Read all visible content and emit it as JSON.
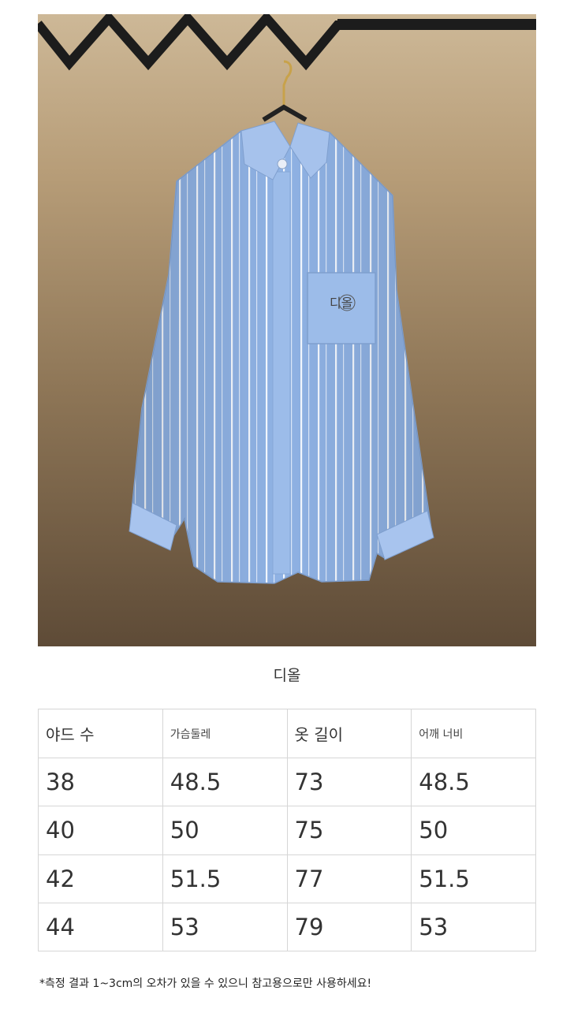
{
  "product": {
    "title": "디올",
    "pocket_logo": "디올"
  },
  "size_table": {
    "headers": [
      "야드 수",
      "가슴둘레",
      "옷 길이",
      "어깨 너비"
    ],
    "rows": [
      [
        "38",
        "48.5",
        "73",
        "48.5"
      ],
      [
        "40",
        "50",
        "75",
        "50"
      ],
      [
        "42",
        "51.5",
        "77",
        "51.5"
      ],
      [
        "44",
        "53",
        "79",
        "53"
      ]
    ]
  },
  "note": "*측정 결과 1~3cm의 오차가 있을 수 있으니 참고용으로만 사용하세요!",
  "colors": {
    "shirt": "#8fb2e4",
    "stripe": "#f4f8ff",
    "backdrop": "#b79d78",
    "rail": "#1c1c1c"
  }
}
